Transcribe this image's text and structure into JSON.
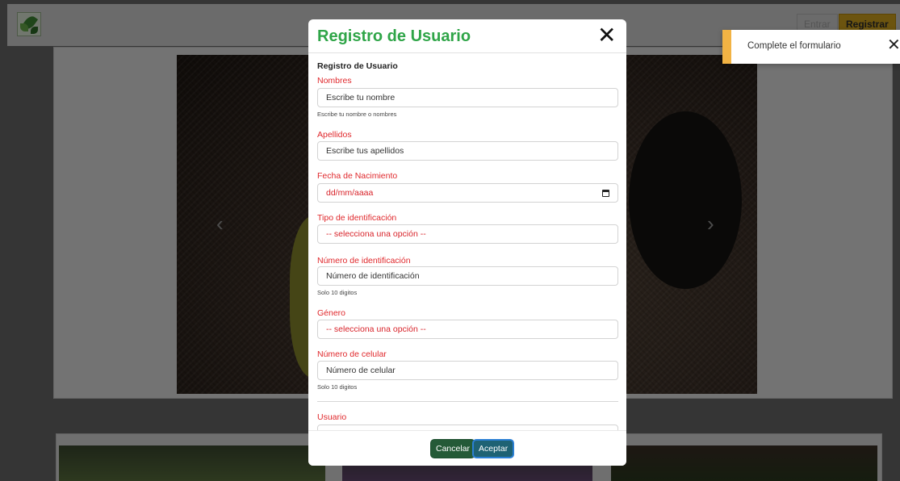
{
  "nav": {
    "login_label": "Entrar",
    "register_label": "Registrar"
  },
  "toast": {
    "message": "Complete el formulario",
    "close_icon": "close-icon",
    "accent_color": "#f2b344"
  },
  "modal": {
    "title": "Registro de Usuario",
    "form_heading": "Registro de Usuario",
    "fields": {
      "nombres": {
        "label": "Nombres",
        "placeholder": "Escribe tu nombre",
        "help": "Escribe tu nombre o nombres"
      },
      "apellidos": {
        "label": "Apellidos",
        "placeholder": "Escribe tus apellidos"
      },
      "fecha": {
        "label": "Fecha de Nacimiento",
        "value": "dd/mm/aaaa"
      },
      "tipo_id": {
        "label": "Tipo de identificación",
        "value": "-- selecciona una opción --"
      },
      "numero_id": {
        "label": "Número de identificación",
        "placeholder": "Número de identificación",
        "help": "Solo 10 digitos"
      },
      "genero": {
        "label": "Género",
        "value": "-- selecciona una opción --"
      },
      "celular": {
        "label": "Número de celular",
        "placeholder": "Número de celular",
        "help": "Solo 10 digitos"
      },
      "usuario": {
        "label": "Usuario"
      }
    },
    "footer": {
      "cancel_label": "Cancelar",
      "accept_label": "Aceptar"
    },
    "colors": {
      "title": "#2fa548",
      "label": "#e0282c",
      "cancel": "#245a37",
      "accept": "#1e6274"
    }
  },
  "carousel": {
    "prev_icon": "chevron-left-icon",
    "next_icon": "chevron-right-icon"
  }
}
